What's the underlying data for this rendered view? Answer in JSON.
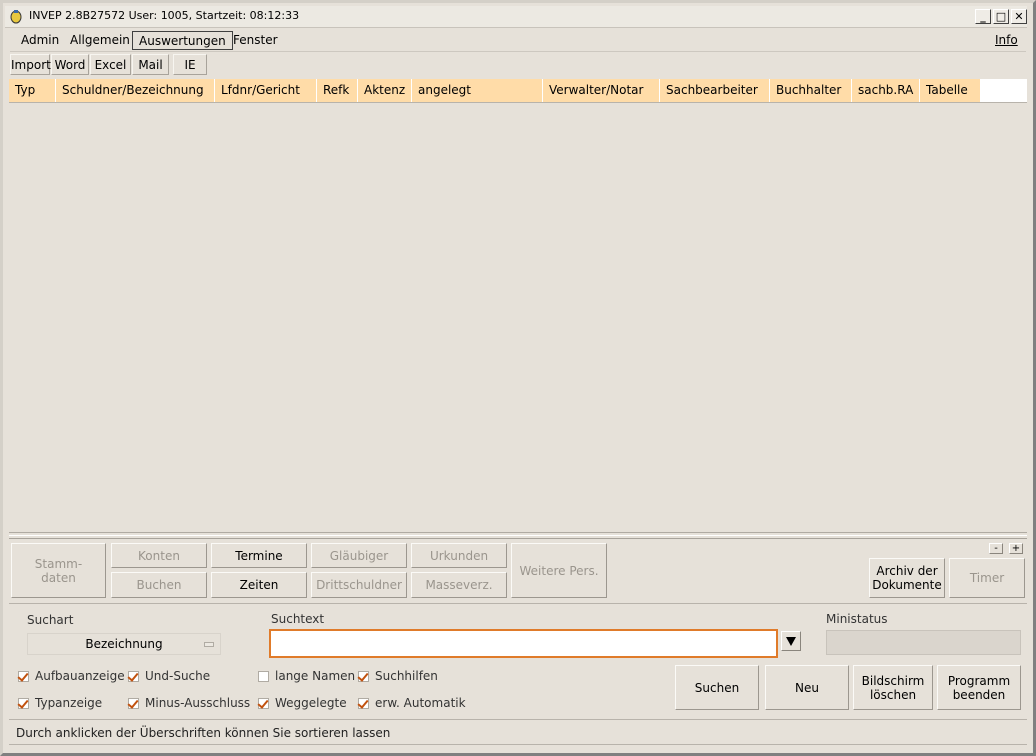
{
  "window": {
    "title": "INVEP 2.8B27572 User: 1005, Startzeit: 08:12:33",
    "controls": [
      "_",
      "□",
      "✕"
    ]
  },
  "menubar": {
    "items": [
      "Admin",
      "Allgemein",
      "Auswertungen",
      "Fenster"
    ],
    "active": "Auswertungen",
    "info": "Info"
  },
  "toolbar": {
    "items": [
      "Import",
      "Word",
      "Excel",
      "Mail",
      "IE"
    ]
  },
  "table": {
    "columns": [
      "Typ",
      "Schuldner/Bezeichnung",
      "Lfdnr/Gericht",
      "Refk",
      "Aktenz",
      "angelegt",
      "Verwalter/Notar",
      "Sachbearbeiter",
      "Buchhalter",
      "sachb.RA",
      "Tabelle"
    ],
    "rows": []
  },
  "actions": {
    "stammdaten": "Stamm-\ndaten",
    "konten": "Konten",
    "termine": "Termine",
    "glaeubiger": "Gläubiger",
    "urkunden": "Urkunden",
    "buchen": "Buchen",
    "zeiten": "Zeiten",
    "drittschuldner": "Drittschuldner",
    "masseverz": "Masseverz.",
    "weitere_pers": "Weitere Pers.",
    "archiv": "Archiv der\nDokumente",
    "timer": "Timer",
    "minus": "-",
    "plus": "+"
  },
  "search": {
    "suchart_label": "Suchart",
    "suchart_value": "Bezeichnung",
    "suchtext_label": "Suchtext",
    "suchtext_value": "",
    "ministatus_label": "Ministatus",
    "options": [
      {
        "label": "Aufbauanzeige",
        "checked": true
      },
      {
        "label": "Und-Suche",
        "checked": true
      },
      {
        "label": "lange Namen",
        "checked": false
      },
      {
        "label": "Suchhilfen",
        "checked": true
      },
      {
        "label": "Typanzeige",
        "checked": true
      },
      {
        "label": "Minus-Ausschluss",
        "checked": true
      },
      {
        "label": "Weggelegte",
        "checked": true
      },
      {
        "label": "erw. Automatik",
        "checked": true
      }
    ],
    "suchen": "Suchen",
    "neu": "Neu",
    "bildschirm_loeschen": "Bildschirm\nlöschen",
    "programm_beenden": "Programm\nbeenden"
  },
  "status": {
    "text": "Durch anklicken der Überschriften können Sie sortieren lassen"
  },
  "colors": {
    "header_bg": "#ffdca8",
    "focus_border": "#e07b2a",
    "check": "#c2520f"
  }
}
